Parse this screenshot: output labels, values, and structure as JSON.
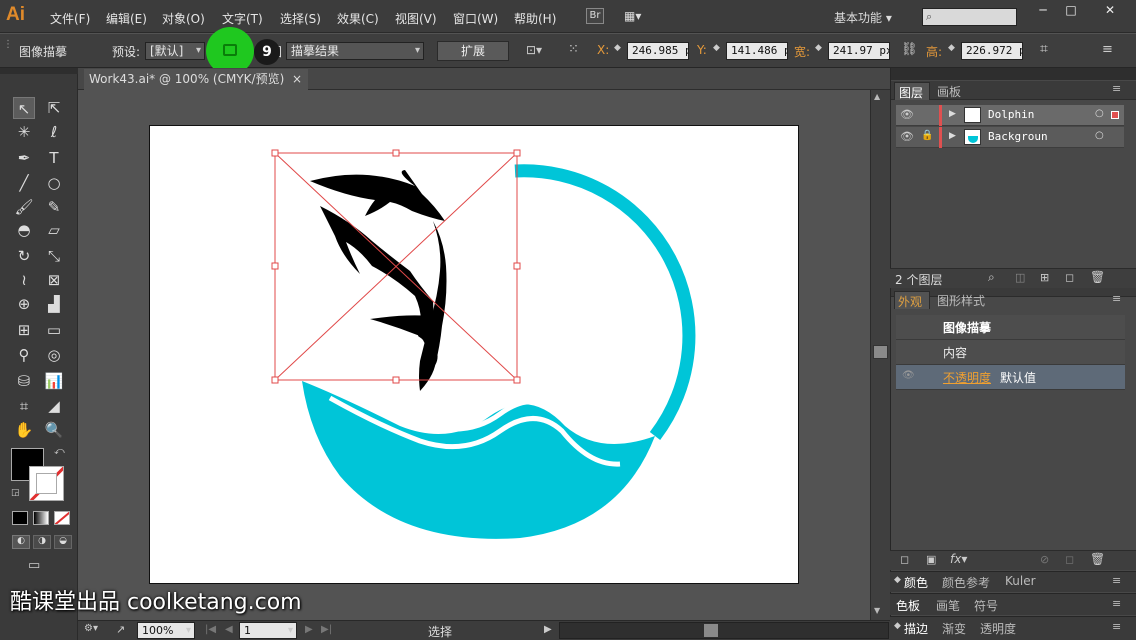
{
  "app": {
    "logo": "Ai",
    "workspace": "基本功能 ▾",
    "bridge": "Br",
    "minimize": "─",
    "restore": "□",
    "close": "✕"
  },
  "menu": [
    "文件(F)",
    "编辑(E)",
    "对象(O)",
    "文字(T)",
    "选择(S)",
    "效果(C)",
    "视图(V)",
    "窗口(W)",
    "帮助(H)"
  ],
  "control": {
    "object_type": "图像描摹",
    "preset_label": "预设:",
    "preset_value": "[默认]",
    "view_label": "视图",
    "view_value": "描摹结果",
    "expand_button": "扩展",
    "x_label": "X:",
    "x_value": "246.985 p",
    "y_label": "Y:",
    "y_value": "141.486 p",
    "w_label": "宽:",
    "w_value": "241.97 px",
    "h_label": "高:",
    "h_value": "226.972 p",
    "step_number": "9"
  },
  "document": {
    "tab_title": "Work43.ai* @ 100% (CMYK/预览)",
    "close_glyph": "×"
  },
  "status": {
    "zoom": "100%",
    "artboard_num": "1",
    "tool_name": "选择"
  },
  "layers_panel": {
    "tabs": [
      "图层",
      "画板"
    ],
    "layers": [
      {
        "name": "Dolphin",
        "color": "#e05050"
      },
      {
        "name": "Backgroun",
        "color": "#e05050"
      }
    ],
    "count": "2 个图层"
  },
  "appearance_panel": {
    "tabs": [
      "外观",
      "图形样式"
    ],
    "title": "图像描摹",
    "content_row": "内容",
    "opacity_label": "不透明度",
    "opacity_value": "默认值"
  },
  "dock": {
    "row1": [
      "颜色",
      "颜色参考",
      "Kuler"
    ],
    "row2": [
      "色板",
      "画笔",
      "符号"
    ],
    "row3": [
      "描边",
      "渐变",
      "透明度"
    ]
  },
  "watermark": "酷课堂出品 coolketang.com",
  "colors": {
    "accent_cyan": "#00c5d8",
    "selection_red": "#e04848"
  }
}
